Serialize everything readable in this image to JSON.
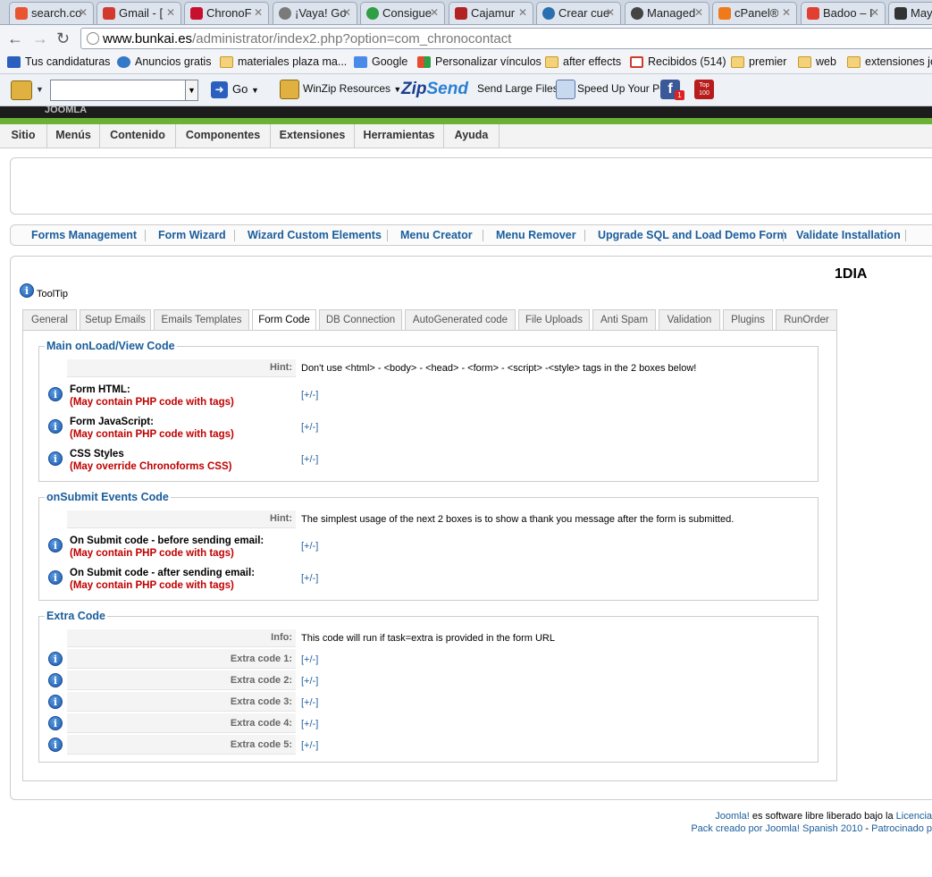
{
  "browser": {
    "tabs": [
      {
        "label": "search.co",
        "color": "#e8552e"
      },
      {
        "label": "Gmail - [",
        "color": "#d23a2e"
      },
      {
        "label": "ChronoF",
        "color": "#c8102e"
      },
      {
        "label": "¡Vaya! Go",
        "color": "#7a7a7a"
      },
      {
        "label": "Consigue",
        "color": "#2f9e44"
      },
      {
        "label": "Cajamur",
        "color": "#b22222"
      },
      {
        "label": "Crear cue",
        "color": "#2a6fb0"
      },
      {
        "label": "Managed",
        "color": "#444444"
      },
      {
        "label": "cPanel®",
        "color": "#f07a1a"
      },
      {
        "label": "Badoo – I",
        "color": "#e04030"
      },
      {
        "label": "Maye",
        "color": "#333333"
      }
    ],
    "url_host": "www.bunkai.es",
    "url_path": "/administrator/index2.php?option=com_chronocontact",
    "bookmarks": [
      {
        "label": "Tus candidaturas",
        "icon": "job-icon"
      },
      {
        "label": "Anuncios gratis",
        "icon": "classifieds-icon"
      },
      {
        "label": "materiales plaza ma...",
        "icon": "folder-icon"
      },
      {
        "label": "Google",
        "icon": "google-icon"
      },
      {
        "label": "Personalizar vínculos",
        "icon": "windows-icon"
      },
      {
        "label": "after effects",
        "icon": "folder-icon"
      },
      {
        "label": "Recibidos (514)",
        "icon": "gmail-icon"
      },
      {
        "label": "premier",
        "icon": "folder-icon"
      },
      {
        "label": "web",
        "icon": "folder-icon"
      },
      {
        "label": "extensiones joo",
        "icon": "folder-icon"
      }
    ],
    "toolbar": {
      "go": "Go",
      "winzip": "WinZip Resources",
      "zipsend_a": "Zip",
      "zipsend_b": "Send",
      "send_large": "Send Large Files",
      "speed_up": "Speed Up Your PC",
      "fb_badge": "1",
      "top100_a": "Top",
      "top100_b": "100"
    }
  },
  "joomla": {
    "header": "JOOMLA",
    "menu": [
      "Sitio",
      "Menús",
      "Contenido",
      "Componentes",
      "Extensiones",
      "Herramientas",
      "Ayuda"
    ],
    "submenu": [
      "Forms Management",
      "Form Wizard",
      "Wizard Custom Elements",
      "Menu Creator",
      "Menu Remover",
      "Upgrade SQL and Load Demo Form",
      "Validate Installation"
    ],
    "form_title": "1DIA",
    "tooltip": "ToolTip",
    "tabs": [
      "General",
      "Setup Emails",
      "Emails Templates",
      "Form Code",
      "DB Connection",
      "AutoGenerated code",
      "File Uploads",
      "Anti Spam",
      "Validation",
      "Plugins",
      "RunOrder"
    ],
    "active_tab": "Form Code",
    "toggle": "[+/-]",
    "main_section": {
      "legend": "Main onLoad/View Code",
      "hint_label": "Hint:",
      "hint_text": "Don't use <html> - <body> - <head> - <form> - <script> -<style> tags in the 2 boxes below!",
      "fields": [
        {
          "label": "Form HTML:",
          "note": "(May contain PHP code with tags)"
        },
        {
          "label": "Form JavaScript:",
          "note": "(May contain PHP code with tags)"
        },
        {
          "label": "CSS Styles",
          "note": "(May override Chronoforms CSS)"
        }
      ]
    },
    "submit_section": {
      "legend": "onSubmit Events Code",
      "hint_label": "Hint:",
      "hint_text": "The simplest usage of the next 2 boxes is to show a thank you message after the form is submitted.",
      "fields": [
        {
          "label": "On Submit code - before sending email:",
          "note": "(May contain PHP code with tags)"
        },
        {
          "label": "On Submit code - after sending email:",
          "note": "(May contain PHP code with tags)"
        }
      ]
    },
    "extra_section": {
      "legend": "Extra Code",
      "info_label": "Info:",
      "info_text": "This code will run if task=extra is provided in the form URL",
      "rows": [
        "Extra code 1:",
        "Extra code 2:",
        "Extra code 3:",
        "Extra code 4:",
        "Extra code 5:"
      ]
    },
    "footer": {
      "joomla": "Joomla!",
      "line1_text": " es software libre liberado bajo la ",
      "licencia": "Licencia",
      "pack": "Pack creado por Joomla! Spanish 2010",
      "dash": " - ",
      "patrocinado": "Patrocinado p"
    }
  }
}
